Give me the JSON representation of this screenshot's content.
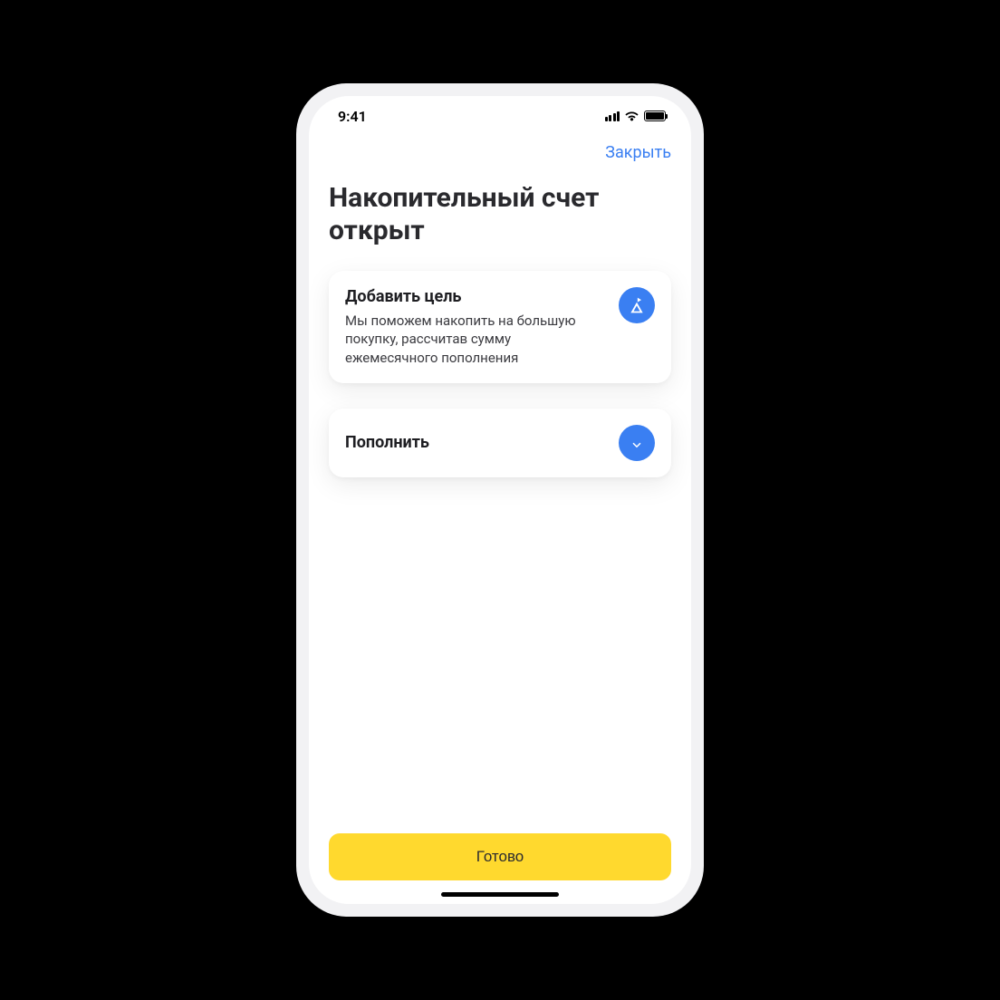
{
  "status": {
    "time": "9:41"
  },
  "nav": {
    "close": "Закрыть"
  },
  "page": {
    "title": "Накопительный счет открыт"
  },
  "cards": {
    "goal": {
      "title": "Добавить цель",
      "desc": "Мы поможем накопить на большую покупку, рассчитав сумму ежемесячного пополнения"
    },
    "topup": {
      "title": "Пополнить"
    }
  },
  "footer": {
    "done": "Готово"
  },
  "colors": {
    "accent": "#3a7ff2",
    "primary": "#ffd92e"
  }
}
